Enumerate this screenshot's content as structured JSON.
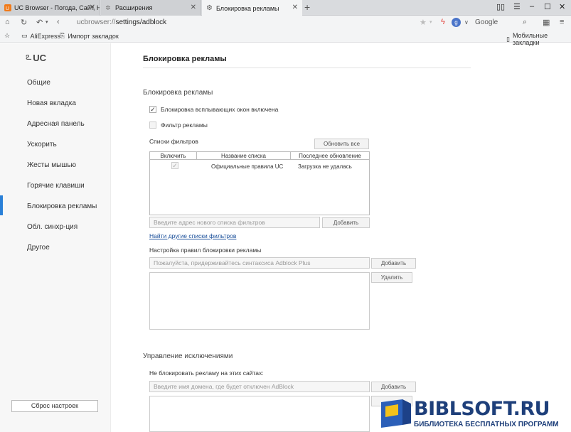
{
  "tabs": [
    {
      "label": "UC Browser - Погода, Сайт, Нов"
    },
    {
      "label": "Расширения"
    },
    {
      "label": "Блокировка рекламы"
    }
  ],
  "toolbar": {
    "url_prefix": "ucbrowser://",
    "url_path": "settings/adblock",
    "search_engine": "Google"
  },
  "bookmarks": {
    "items": [
      {
        "label": "AliExpress"
      },
      {
        "label": "Импорт закладок"
      }
    ],
    "mobile": "Мобильные закладки"
  },
  "sidebar": {
    "logo": "UC",
    "items": [
      {
        "label": "Общие"
      },
      {
        "label": "Новая вкладка"
      },
      {
        "label": "Адресная панель"
      },
      {
        "label": "Ускорить"
      },
      {
        "label": "Жесты мышью"
      },
      {
        "label": "Горячие клавиши"
      },
      {
        "label": "Блокировка рекламы"
      },
      {
        "label": "Обл. синхр-ция"
      },
      {
        "label": "Другое"
      }
    ],
    "active_index": 6,
    "reset_label": "Сброс настроек",
    "accent_color": "#2a80d8"
  },
  "main": {
    "title": "Блокировка рекламы",
    "section1": "Блокировка рекламы",
    "popup_block_label": "Блокировка всплывающих окон включена",
    "popup_block_checked": true,
    "ad_filter_label": "Фильтр рекламы",
    "ad_filter_checked": false,
    "filter_lists_label": "Списки фильтров",
    "update_all_button": "Обновить все",
    "table": {
      "headers": [
        "Включить",
        "Название списка",
        "Последнее обновление"
      ],
      "rows": [
        {
          "enabled": true,
          "name": "Официальные правила UC",
          "updated": "Загрузка не удалась"
        }
      ]
    },
    "new_list_placeholder": "Введите адрес нового списка фильтров",
    "add_button": "Добавить",
    "find_lists_link": "Найти другие списки фильтров",
    "rules_label": "Настройка правил блокировки рекламы",
    "rules_placeholder": "Пожалуйста, придерживайтесь синтаксиса Adblock Plus",
    "rules_add_button": "Добавить",
    "rules_delete_button": "Удалить",
    "exceptions_title": "Управление исключениями",
    "exceptions_label": "Не блокировать рекламу на этих сайтах:",
    "exceptions_placeholder": "Введите имя домена, где будет отключен AdBlock",
    "exceptions_add_button": "Добавить"
  },
  "watermark": {
    "title": "BIBLSOFT.RU",
    "subtitle": "БИБЛИОТЕКА БЕСПЛАТНЫХ ПРОГРАММ"
  }
}
